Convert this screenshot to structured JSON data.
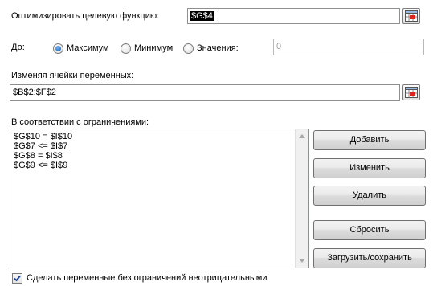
{
  "objective": {
    "label": "Оптимизировать целевую функцию:",
    "value": "$G$4"
  },
  "to": {
    "label": "До:",
    "options": [
      {
        "label": "Максимум",
        "selected": true
      },
      {
        "label": "Минимум",
        "selected": false
      },
      {
        "label": "Значения:",
        "selected": false
      }
    ],
    "value_input": "0"
  },
  "variables": {
    "label": "Изменяя ячейки переменных:",
    "value": "$B$2:$F$2"
  },
  "constraints": {
    "label": "В соответствии с ограничениями:",
    "items": [
      "$G$10 = $I$10",
      "$G$7 <= $I$7",
      "$G$8 = $I$8",
      "$G$9 <= $I$9"
    ]
  },
  "buttons": {
    "add": "Добавить",
    "change": "Изменить",
    "delete": "Удалить",
    "reset": "Сбросить",
    "load_save": "Загрузить/сохранить"
  },
  "nonnegative": {
    "label": "Сделать переменные без ограничений неотрицательными",
    "checked": true
  },
  "icons": {
    "range_picker": "range-picker-icon",
    "checkmark": "checkmark-icon",
    "scroll_up": "scroll-up-arrow-icon",
    "scroll_down": "scroll-down-arrow-icon"
  }
}
